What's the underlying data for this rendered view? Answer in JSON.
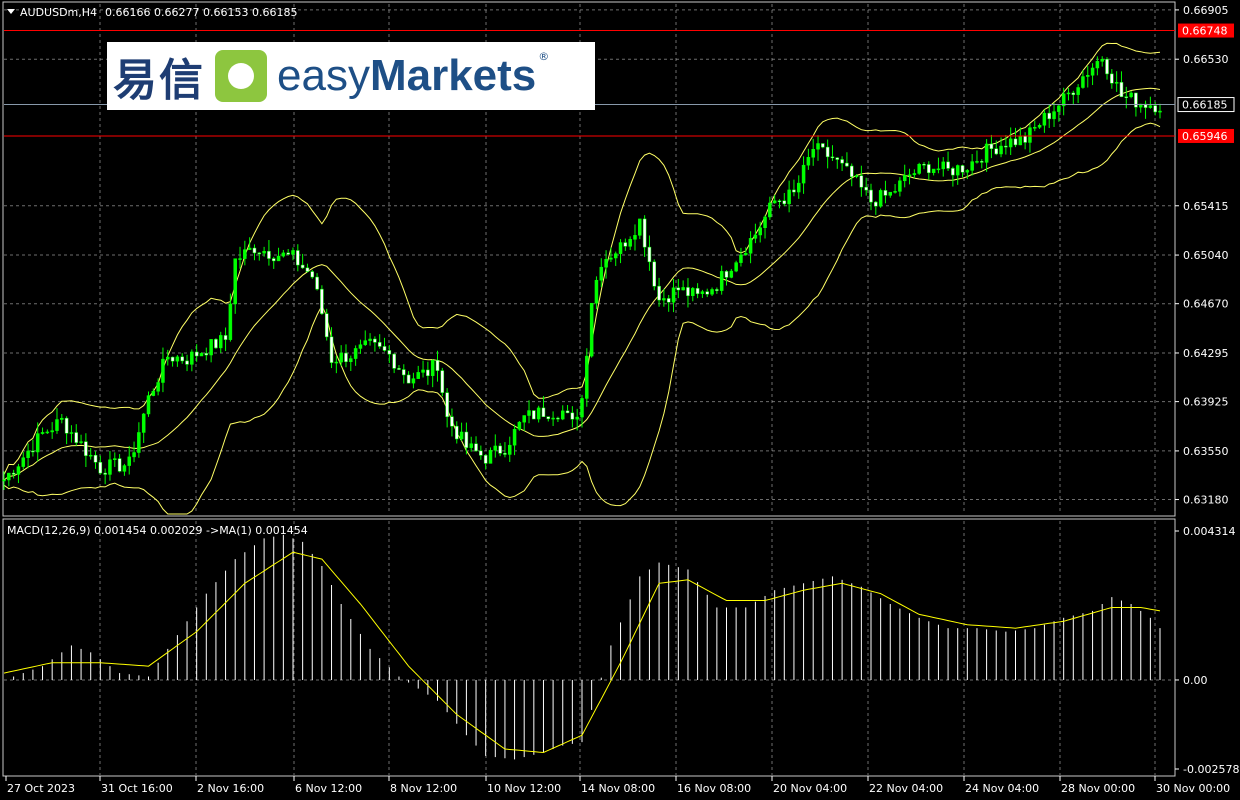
{
  "header": {
    "symbol": "AUDUSDm,H4",
    "ohlc": "0.66166 0.66277 0.66153 0.66185"
  },
  "macd_header": "MACD(12,26,9) 0.001454 0.002029  ->MA(1) 0.001454",
  "logo": {
    "chinese": "易信",
    "brand_light": "easy",
    "brand_bold": "Markets",
    "reg_mark": "®"
  },
  "colors": {
    "background": "#000000",
    "grid": "#c8c8c8",
    "bull_candle": "#00ff00",
    "bear_candle": "#ffffff",
    "bands": "#ffff66",
    "hline": "#ff0000",
    "histogram": "#ffffff",
    "signal": "#ffff00"
  },
  "chart_data": [
    {
      "type": "candlestick",
      "title": "AUDUSDm,H4",
      "y_ticks": [
        "0.66905",
        "0.66530",
        "0.66185",
        "0.65946",
        "0.65415",
        "0.65040",
        "0.64670",
        "0.64295",
        "0.63925",
        "0.63550",
        "0.63180"
      ],
      "ylim": [
        0.6307,
        0.6695
      ],
      "current_price": "0.66185",
      "horizontal_lines": [
        "0.66748",
        "0.65946"
      ],
      "x_ticks": [
        "27 Oct 2023",
        "31 Oct 16:00",
        "2 Nov 16:00",
        "6 Nov 12:00",
        "8 Nov 12:00",
        "10 Nov 12:00",
        "14 Nov 08:00",
        "16 Nov 08:00",
        "20 Nov 04:00",
        "22 Nov 04:00",
        "24 Nov 04:00",
        "28 Nov 00:00",
        "30 Nov 00:00"
      ],
      "overlay": "Bollinger Bands",
      "close_path": [
        [
          0,
          0.6333
        ],
        [
          8,
          0.6368
        ],
        [
          12,
          0.6378
        ],
        [
          16,
          0.636
        ],
        [
          20,
          0.6342
        ],
        [
          26,
          0.6345
        ],
        [
          30,
          0.6395
        ],
        [
          34,
          0.6427
        ],
        [
          38,
          0.6425
        ],
        [
          42,
          0.6433
        ],
        [
          46,
          0.644
        ],
        [
          48,
          0.65
        ],
        [
          52,
          0.651
        ],
        [
          56,
          0.6505
        ],
        [
          60,
          0.6502
        ],
        [
          64,
          0.6488
        ],
        [
          66,
          0.646
        ],
        [
          68,
          0.6425
        ],
        [
          72,
          0.6428
        ],
        [
          76,
          0.6435
        ],
        [
          80,
          0.6428
        ],
        [
          84,
          0.641
        ],
        [
          88,
          0.6415
        ],
        [
          90,
          0.6422
        ],
        [
          92,
          0.638
        ],
        [
          96,
          0.6358
        ],
        [
          100,
          0.635
        ],
        [
          104,
          0.6358
        ],
        [
          108,
          0.638
        ],
        [
          112,
          0.6385
        ],
        [
          116,
          0.6385
        ],
        [
          118,
          0.6375
        ],
        [
          120,
          0.6395
        ],
        [
          122,
          0.647
        ],
        [
          124,
          0.65
        ],
        [
          128,
          0.651
        ],
        [
          132,
          0.653
        ],
        [
          134,
          0.65
        ],
        [
          136,
          0.647
        ],
        [
          140,
          0.6478
        ],
        [
          144,
          0.6472
        ],
        [
          148,
          0.6482
        ],
        [
          152,
          0.6502
        ],
        [
          156,
          0.652
        ],
        [
          160,
          0.6545
        ],
        [
          164,
          0.655
        ],
        [
          168,
          0.6585
        ],
        [
          172,
          0.6578
        ],
        [
          176,
          0.6563
        ],
        [
          180,
          0.6545
        ],
        [
          184,
          0.655
        ],
        [
          188,
          0.6565
        ],
        [
          192,
          0.6572
        ],
        [
          196,
          0.6568
        ],
        [
          200,
          0.6572
        ],
        [
          204,
          0.6583
        ],
        [
          208,
          0.659
        ],
        [
          212,
          0.6592
        ],
        [
          216,
          0.6608
        ],
        [
          220,
          0.6622
        ],
        [
          224,
          0.664
        ],
        [
          228,
          0.6655
        ],
        [
          232,
          0.6625
        ],
        [
          236,
          0.662
        ],
        [
          240,
          0.6618
        ]
      ]
    },
    {
      "type": "bar",
      "title": "MACD(12,26,9)",
      "y_ticks": [
        "0.004314",
        "0.00",
        "-0.002578"
      ],
      "ylim": [
        -0.002578,
        0.004314
      ],
      "series": [
        {
          "name": "MACD",
          "anchors": [
            [
              0,
              0.0
            ],
            [
              8,
              0.0004
            ],
            [
              14,
              0.001
            ],
            [
              18,
              0.0008
            ],
            [
              24,
              0.0002
            ],
            [
              30,
              0.0001
            ],
            [
              36,
              0.0013
            ],
            [
              42,
              0.0025
            ],
            [
              48,
              0.0035
            ],
            [
              54,
              0.0041
            ],
            [
              58,
              0.0042
            ],
            [
              62,
              0.004
            ],
            [
              66,
              0.0033
            ],
            [
              70,
              0.0022
            ],
            [
              76,
              0.0009
            ],
            [
              82,
              0.0001
            ],
            [
              90,
              -0.0006
            ],
            [
              96,
              -0.0016
            ],
            [
              100,
              -0.0022
            ],
            [
              106,
              -0.0023
            ],
            [
              112,
              -0.0021
            ],
            [
              116,
              -0.0019
            ],
            [
              120,
              -0.0018
            ],
            [
              126,
              0.001
            ],
            [
              132,
              0.003
            ],
            [
              136,
              0.0034
            ],
            [
              142,
              0.0032
            ],
            [
              148,
              0.0021
            ],
            [
              154,
              0.0021
            ],
            [
              160,
              0.0026
            ],
            [
              166,
              0.0028
            ],
            [
              172,
              0.003
            ],
            [
              178,
              0.0027
            ],
            [
              184,
              0.0022
            ],
            [
              190,
              0.0018
            ],
            [
              196,
              0.0015
            ],
            [
              202,
              0.0015
            ],
            [
              208,
              0.0014
            ],
            [
              214,
              0.0015
            ],
            [
              220,
              0.0018
            ],
            [
              226,
              0.002
            ],
            [
              230,
              0.0024
            ],
            [
              234,
              0.0022
            ],
            [
              238,
              0.0018
            ],
            [
              240,
              0.0015
            ]
          ]
        },
        {
          "name": "Signal",
          "anchors": [
            [
              0,
              0.0002
            ],
            [
              10,
              0.0005
            ],
            [
              20,
              0.0005
            ],
            [
              30,
              0.0004
            ],
            [
              40,
              0.0014
            ],
            [
              50,
              0.0028
            ],
            [
              60,
              0.0037
            ],
            [
              66,
              0.0035
            ],
            [
              74,
              0.0022
            ],
            [
              84,
              0.0004
            ],
            [
              94,
              -0.001
            ],
            [
              104,
              -0.002
            ],
            [
              112,
              -0.0021
            ],
            [
              120,
              -0.0016
            ],
            [
              128,
              0.0005
            ],
            [
              136,
              0.0028
            ],
            [
              142,
              0.0029
            ],
            [
              150,
              0.0023
            ],
            [
              158,
              0.0023
            ],
            [
              166,
              0.0026
            ],
            [
              174,
              0.0028
            ],
            [
              182,
              0.0025
            ],
            [
              190,
              0.0019
            ],
            [
              200,
              0.0016
            ],
            [
              210,
              0.0015
            ],
            [
              220,
              0.0017
            ],
            [
              230,
              0.0021
            ],
            [
              236,
              0.0021
            ],
            [
              240,
              0.002
            ]
          ]
        }
      ]
    }
  ]
}
